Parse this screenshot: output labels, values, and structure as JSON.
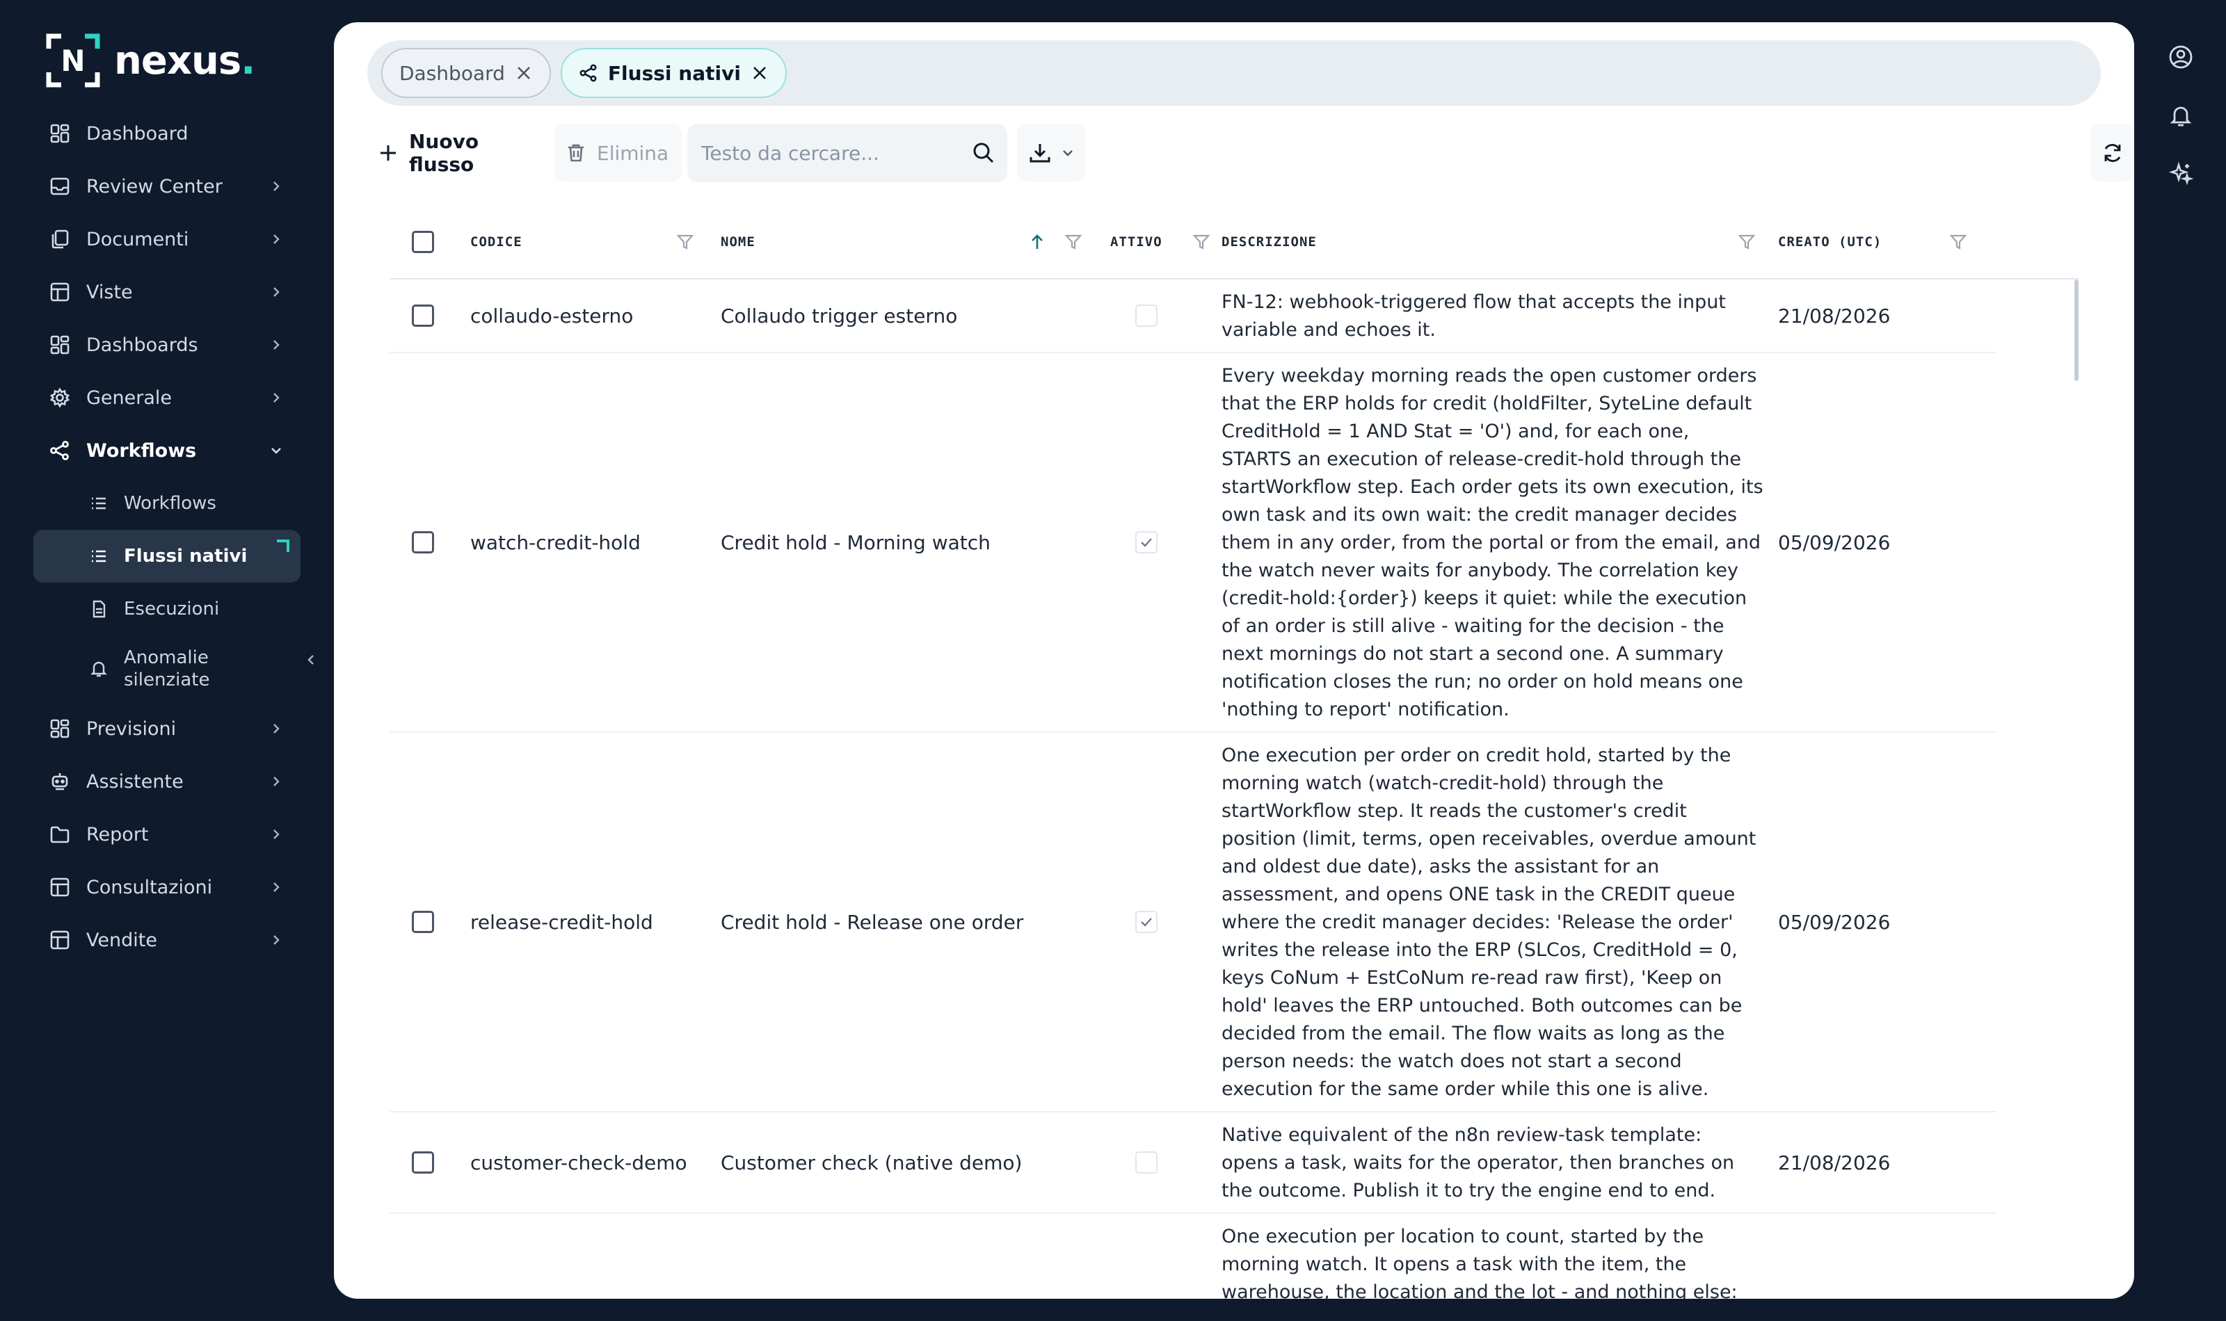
{
  "brand": {
    "name": "nexus",
    "dot": ".",
    "mark": "N",
    "accent": "#2dd4bf"
  },
  "sidebar": {
    "items": [
      {
        "label": "Dashboard",
        "icon": "grid-icon"
      },
      {
        "label": "Review Center",
        "icon": "inbox-icon"
      },
      {
        "label": "Documenti",
        "icon": "copy-icon"
      },
      {
        "label": "Viste",
        "icon": "table-icon"
      },
      {
        "label": "Dashboards",
        "icon": "grid-icon"
      },
      {
        "label": "Generale",
        "icon": "gear-icon"
      },
      {
        "label": "Workflows",
        "icon": "share-nodes-icon"
      }
    ],
    "workflow_children": [
      {
        "label": "Workflows",
        "icon": "list-icon"
      },
      {
        "label": "Flussi nativi",
        "icon": "list-icon"
      },
      {
        "label": "Esecuzioni",
        "icon": "file-icon"
      },
      {
        "label": "Anomalie silenziate",
        "icon": "bell-icon"
      }
    ],
    "items_after": [
      {
        "label": "Previsioni",
        "icon": "grid-icon"
      },
      {
        "label": "Assistente",
        "icon": "robot-icon"
      },
      {
        "label": "Report",
        "icon": "folder-icon"
      },
      {
        "label": "Consultazioni",
        "icon": "table-icon"
      },
      {
        "label": "Vendite",
        "icon": "table-icon"
      }
    ]
  },
  "tabs": [
    {
      "label": "Dashboard",
      "active": false
    },
    {
      "label": "Flussi nativi",
      "active": true
    }
  ],
  "toolbar": {
    "new_label": "Nuovo flusso",
    "delete_label": "Elimina",
    "search_placeholder": "Testo da cercare..."
  },
  "table": {
    "columns": {
      "code": "CODICE",
      "name": "NOME",
      "active": "ATTIVO",
      "description": "DESCRIZIONE",
      "created": "CREATO (UTC)"
    },
    "rows": [
      {
        "code": "collaudo-esterno",
        "name": "Collaudo trigger esterno",
        "active": false,
        "description": "FN-12: webhook-triggered flow that accepts the input variable and echoes it.",
        "created": "21/08/2026"
      },
      {
        "code": "watch-credit-hold",
        "name": "Credit hold - Morning watch",
        "active": true,
        "description": "Every weekday morning reads the open customer orders that the ERP holds for credit (holdFilter, SyteLine default CreditHold = 1 AND Stat = 'O') and, for each one, STARTS an execution of release-credit-hold through the startWorkflow step. Each order gets its own execution, its own task and its own wait: the credit manager decides them in any order, from the portal or from the email, and the watch never waits for anybody. The correlation key (credit-hold:{order}) keeps it quiet: while the execution of an order is still alive - waiting for the decision - the next mornings do not start a second one. A summary notification closes the run; no order on hold means one 'nothing to report' notification.",
        "created": "05/09/2026"
      },
      {
        "code": "release-credit-hold",
        "name": "Credit hold - Release one order",
        "active": true,
        "description": "One execution per order on credit hold, started by the morning watch (watch-credit-hold) through the startWorkflow step. It reads the customer's credit position (limit, terms, open receivables, overdue amount and oldest due date), asks the assistant for an assessment, and opens ONE task in the CREDIT queue where the credit manager decides: 'Release the order' writes the release into the ERP (SLCos, CreditHold = 0, keys CoNum + EstCoNum re-read raw first), 'Keep on hold' leaves the ERP untouched. Both outcomes can be decided from the email. The flow waits as long as the person needs: the watch does not start a second execution for the same order while this one is alive.",
        "created": "05/09/2026"
      },
      {
        "code": "customer-check-demo",
        "name": "Customer check (native demo)",
        "active": false,
        "description": "Native equivalent of the n8n review-task template: opens a task, waits for the operator, then branches on the outcome. Publish it to try the engine end to end.",
        "created": "21/08/2026"
      },
      {
        "code": "",
        "name": "",
        "active": false,
        "description": "One execution per location to count, started by the morning watch. It opens a task with the item, the warehouse, the location and the lot - and nothing else:",
        "created": ""
      }
    ]
  }
}
